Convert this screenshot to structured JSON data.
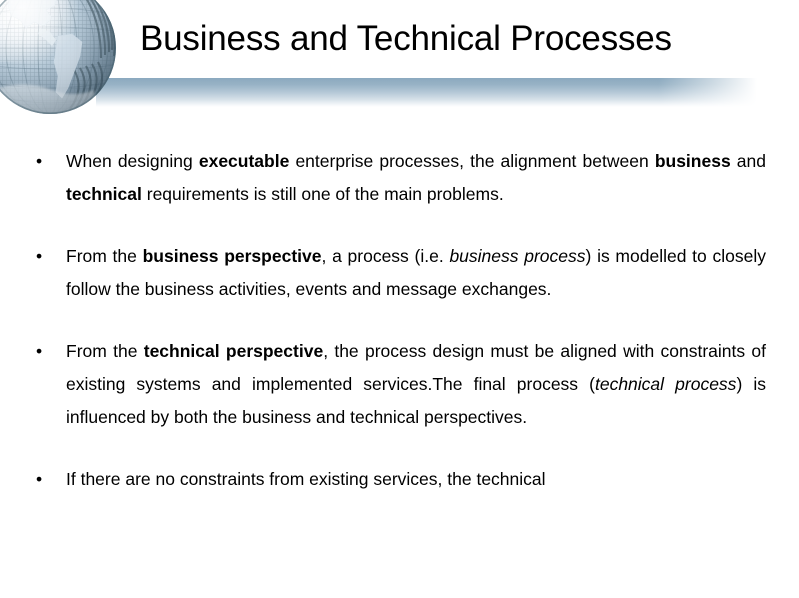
{
  "slide": {
    "title": "Business and Technical Processes",
    "bullet_marker": "•",
    "decor": {
      "globe_icon": "globe-graphic",
      "separator_color": "#8ba9bf"
    },
    "bullets": [
      {
        "id": "bullet-1",
        "plain_text": "When designing executable enterprise processes, the alignment between business and technical requirements is still one of the main problems.",
        "runs": [
          {
            "t": "When designing ",
            "s": "normal"
          },
          {
            "t": "executable",
            "s": "bold"
          },
          {
            "t": " enterprise processes, the alignment between ",
            "s": "normal"
          },
          {
            "t": "business",
            "s": "bold"
          },
          {
            "t": " and ",
            "s": "normal"
          },
          {
            "t": "technical",
            "s": "bold"
          },
          {
            "t": " requirements is still one of the main problems.",
            "s": "normal"
          }
        ]
      },
      {
        "id": "bullet-2",
        "plain_text": "From the business perspective, a process (i.e. business process) is modelled to closely follow the business activities, events and message exchanges.",
        "runs": [
          {
            "t": "From the ",
            "s": "normal"
          },
          {
            "t": "business perspective",
            "s": "bold"
          },
          {
            "t": ", a process (i.e. ",
            "s": "normal"
          },
          {
            "t": "business process",
            "s": "italic"
          },
          {
            "t": ") is modelled to closely follow the business activities, events and message exchanges.",
            "s": "normal"
          }
        ]
      },
      {
        "id": "bullet-3",
        "plain_text": "From the technical perspective, the process design must be aligned with constraints of existing systems and implemented services.The final process (technical process) is influenced by both the business and technical perspectives.",
        "runs": [
          {
            "t": "From the ",
            "s": "normal"
          },
          {
            "t": "technical perspective",
            "s": "bold"
          },
          {
            "t": ", the process design must be aligned with constraints of existing systems and implemented services.The final process (",
            "s": "normal"
          },
          {
            "t": "technical process",
            "s": "italic"
          },
          {
            "t": ") is influenced by both the business and technical perspectives.",
            "s": "normal"
          }
        ]
      },
      {
        "id": "bullet-4",
        "truncated": true,
        "plain_text": "If there are no constraints from existing services, the technical",
        "runs": [
          {
            "t": "If there are no constraints from existing services, the technical",
            "s": "normal"
          }
        ]
      }
    ]
  }
}
